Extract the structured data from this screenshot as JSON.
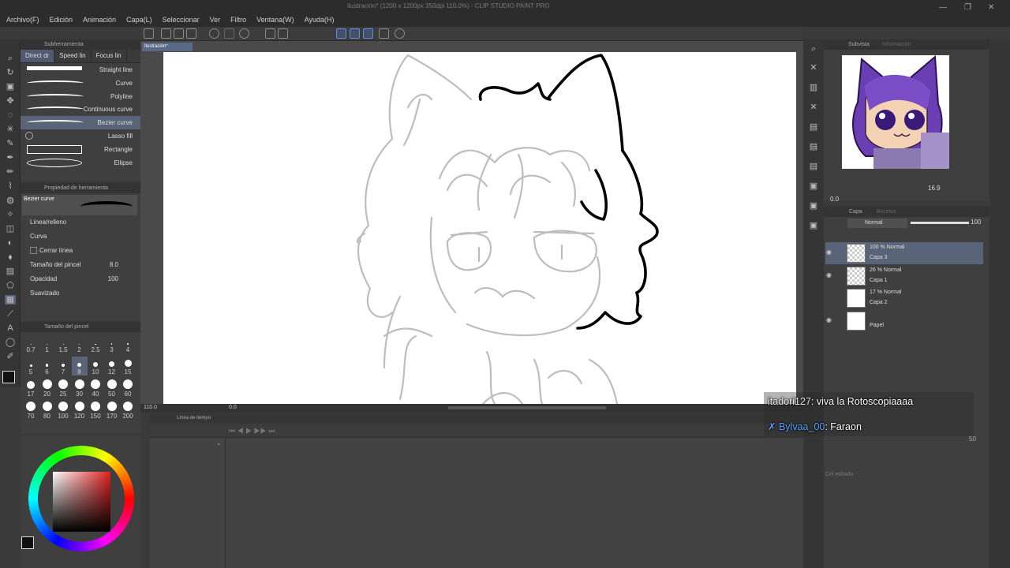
{
  "window": {
    "title": "Ilustración* (1200 x 1200px 350dpi 110.0%) - CLIP STUDIO PAINT PRO",
    "controls": [
      "—",
      "❐",
      "✕"
    ]
  },
  "menu": [
    "Archivo(F)",
    "Edición",
    "Animación",
    "Capa(L)",
    "Seleccionar",
    "Ver",
    "Filtro",
    "Ventana(W)",
    "Ayuda(H)"
  ],
  "canvas_tab": "Ilustración*",
  "subtool": {
    "panel_title": "Subherramienta",
    "tabs": [
      "Direct dr",
      "Speed lin",
      "Focus lin"
    ],
    "brushes": [
      {
        "label": "Straight line"
      },
      {
        "label": "Curve"
      },
      {
        "label": "Polyline"
      },
      {
        "label": "Continuous curve"
      },
      {
        "label": "Bezier curve"
      },
      {
        "label": "Lasso fill"
      },
      {
        "label": "Rectangle"
      },
      {
        "label": "Ellipse"
      }
    ],
    "selected": "Bezier curve"
  },
  "tool_property": {
    "panel_title": "Propiedad de herramienta",
    "preview_label": "Bezier curve",
    "rows": {
      "line_fill": "Línea/relleno",
      "curve": "Curva",
      "close_line": "Cerrar línea",
      "brush_size": "Tamaño del pincel",
      "brush_size_value": "8.0",
      "opacity": "Opacidad",
      "opacity_value": "100",
      "smoothing": "Suavizado"
    }
  },
  "brush_size_panel": {
    "panel_title": "Tamaño del pincel",
    "sizes": [
      "0.7",
      "1",
      "1.5",
      "2",
      "2.5",
      "3",
      "4",
      "5",
      "6",
      "7",
      "8",
      "10",
      "12",
      "15",
      "17",
      "20",
      "25",
      "30",
      "40",
      "50",
      "60",
      "70",
      "80",
      "100",
      "120",
      "150",
      "170",
      "200"
    ],
    "selected": "8"
  },
  "navigator": {
    "zoom": "110.0",
    "rotation": "0.0"
  },
  "timeline": {
    "panel_title": "Línea de tiempo"
  },
  "subview": {
    "tabs": [
      "Subvista",
      "Información"
    ],
    "zoom": "16.9",
    "rotation": "0.0"
  },
  "layers_panel": {
    "tabs": [
      "Capa",
      "Bocetos"
    ],
    "blend_mode": "Normal",
    "opacity": "100",
    "layers": [
      {
        "mode": "100 % Normal",
        "name": "Capa 3",
        "visible": true,
        "selected": true
      },
      {
        "mode": "26 % Normal",
        "name": "Capa 1",
        "visible": true,
        "selected": false
      },
      {
        "mode": "17 % Normal",
        "name": "Capa 2",
        "visible": false,
        "selected": false
      },
      {
        "mode": "",
        "name": "Papel",
        "visible": true,
        "selected": false
      }
    ]
  },
  "lower_right": {
    "status": "Cel editado",
    "opacity_value": "50"
  },
  "chat": {
    "messages": [
      {
        "user": "itadori127",
        "text": "viva la Rotoscopiaaaa",
        "user_color": "#e8e8e8"
      },
      {
        "user": "Bylvaa_00",
        "text": "Faraon",
        "user_color": "#5aa0ff"
      }
    ]
  },
  "colors": {
    "accent_selection": "#5a6478",
    "panel_bg": "#3f3f3f",
    "canvas_paper": "#ffffff"
  }
}
